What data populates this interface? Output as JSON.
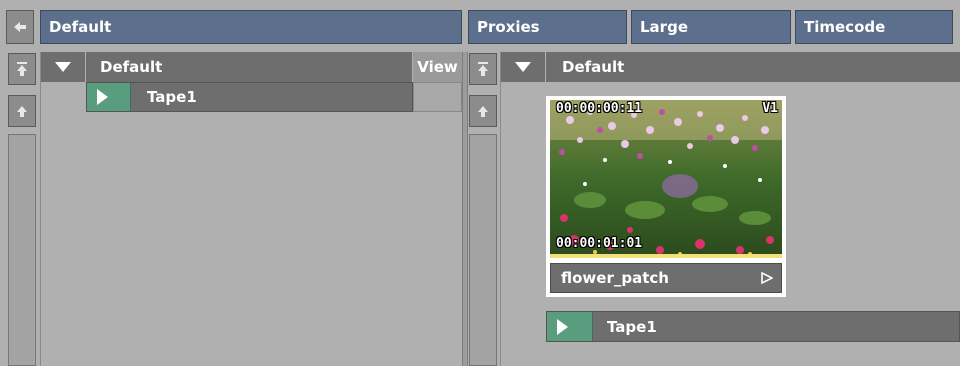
{
  "top_bar": {
    "library_label": "Default",
    "proxies_label": "Proxies",
    "size_label": "Large",
    "display_label": "Timecode"
  },
  "left_panel": {
    "header_label": "Default",
    "view_label": "View",
    "rows": [
      {
        "label": "Tape1"
      }
    ]
  },
  "right_panel": {
    "header_label": "Default",
    "clip": {
      "name": "flower_patch",
      "timecode_in": "00:00:00:11",
      "timecode_out": "00:00:01:01",
      "track_badge": "V1"
    },
    "rows": [
      {
        "label": "Tape1"
      }
    ]
  },
  "colors": {
    "button_blue": "#5c6f8c",
    "panel_grey": "#b0b0b0",
    "header_dark": "#6e6e6e",
    "play_green": "#5a9c7e"
  },
  "icons": [
    "arrow-left-icon",
    "jump-top-icon",
    "arrow-up-icon",
    "expand-triangle-icon",
    "play-icon",
    "open-triangle-icon"
  ]
}
